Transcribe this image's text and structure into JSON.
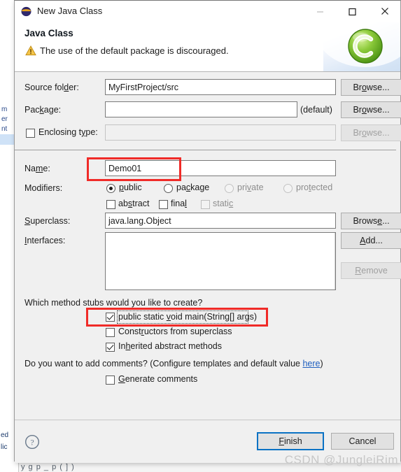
{
  "window": {
    "title": "New Java Class",
    "icon": "eclipse-logo-icon",
    "controls": {
      "minimize": "—",
      "maximize": "☐",
      "close": "✕"
    }
  },
  "header": {
    "title": "Java Class",
    "warning_icon": "warning-triangle-icon",
    "message": "The use of the default package is discouraged.",
    "banner_icon": "java-class-green-c-icon"
  },
  "form": {
    "source_folder": {
      "label": "Source folder:",
      "value": "MyFirstProject/src",
      "button": "Browse..."
    },
    "package": {
      "label": "Package:",
      "value": "",
      "suffix": "(default)",
      "button": "Browse..."
    },
    "enclosing_type": {
      "label": "Enclosing type:",
      "checked": false,
      "value": "",
      "button": "Browse...",
      "disabled": true
    },
    "name": {
      "label": "Name:",
      "value": "Demo01"
    },
    "modifiers": {
      "label": "Modifiers:",
      "radios": [
        {
          "label": "public",
          "checked": true,
          "disabled": false
        },
        {
          "label": "package",
          "checked": false,
          "disabled": false
        },
        {
          "label": "private",
          "checked": false,
          "disabled": true
        },
        {
          "label": "protected",
          "checked": false,
          "disabled": true
        }
      ],
      "checkboxes": [
        {
          "label": "abstract",
          "checked": false,
          "disabled": false
        },
        {
          "label": "final",
          "checked": false,
          "disabled": false
        },
        {
          "label": "static",
          "checked": false,
          "disabled": true
        }
      ]
    },
    "superclass": {
      "label": "Superclass:",
      "value": "java.lang.Object",
      "button": "Browse..."
    },
    "interfaces": {
      "label": "Interfaces:",
      "items": [],
      "add_button": "Add...",
      "remove_button": "Remove",
      "remove_disabled": true
    },
    "method_stubs": {
      "question": "Which method stubs would you like to create?",
      "options": [
        {
          "label": "public static void main(String[] args)",
          "checked": true,
          "focused": true
        },
        {
          "label": "Constructors from superclass",
          "checked": false,
          "focused": false
        },
        {
          "label": "Inherited abstract methods",
          "checked": true,
          "focused": false
        }
      ]
    },
    "comments": {
      "question_prefix": "Do you want to add comments? (Configure templates and default value ",
      "link": "here",
      "question_suffix": ")",
      "checkbox": {
        "label": "Generate comments",
        "checked": false
      }
    }
  },
  "footer": {
    "help_icon": "help-question-icon",
    "finish_label": "Finish",
    "cancel_label": "Cancel"
  },
  "annotations": {
    "accent_color": "#f02b28",
    "boxes": [
      "name-field-highlight",
      "main-method-checkbox-highlight"
    ]
  },
  "watermark": "CSDN @JungleiRim",
  "background": {
    "tree_lines": "m\ner\nnt",
    "bottom_lines": "ed\nlic",
    "code_line": "y   g       p     _  p      (   ]     )"
  }
}
